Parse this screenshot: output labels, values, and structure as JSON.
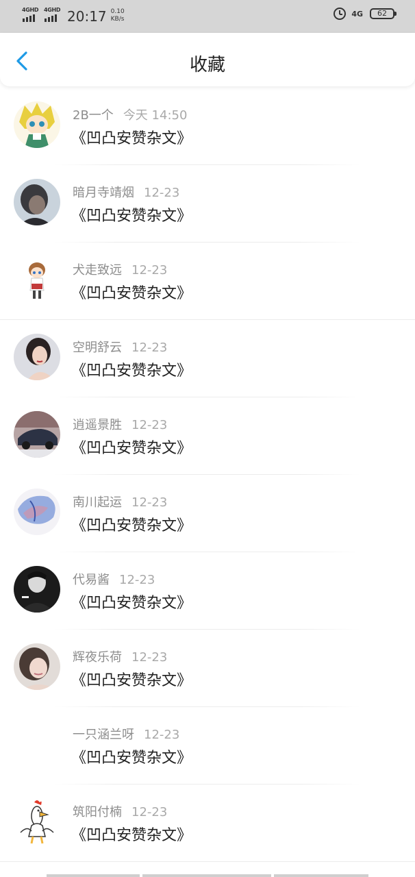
{
  "status_bar": {
    "signal1": "4GHD",
    "signal2": "4GHD",
    "time": "20:17",
    "speed_value": "0.10",
    "speed_unit": "KB/s",
    "network": "4G",
    "battery": "62"
  },
  "header": {
    "title": "收藏",
    "back_icon": "chevron-left-icon",
    "accent_color": "#1e9ae6"
  },
  "items": [
    {
      "author": "2B一个",
      "date": "今天 14:50",
      "title": "《凹凸安赞杂文》",
      "avatar": "anime-girl"
    },
    {
      "author": "暗月寺靖烟",
      "date": "12-23",
      "title": "《凹凸安赞杂文》",
      "avatar": "photo-dark"
    },
    {
      "author": "犬走致远",
      "date": "12-23",
      "title": "《凹凸安赞杂文》",
      "avatar": "anime-boy"
    },
    {
      "author": "空明舒云",
      "date": "12-23",
      "title": "《凹凸安赞杂文》",
      "avatar": "photo-woman"
    },
    {
      "author": "逍遥景胜",
      "date": "12-23",
      "title": "《凹凸安赞杂文》",
      "avatar": "photo-car"
    },
    {
      "author": "南川起运",
      "date": "12-23",
      "title": "《凹凸安赞杂文》",
      "avatar": "anime-blue"
    },
    {
      "author": "代易酱",
      "date": "12-23",
      "title": "《凹凸安赞杂文》",
      "avatar": "photo-man"
    },
    {
      "author": "辉夜乐荷",
      "date": "12-23",
      "title": "《凹凸安赞杂文》",
      "avatar": "photo-girl"
    },
    {
      "author": "一只涵兰呀",
      "date": "12-23",
      "title": "《凹凸安赞杂文》",
      "avatar": "none"
    },
    {
      "author": "筑阳付楠",
      "date": "12-23",
      "title": "《凹凸安赞杂文》",
      "avatar": "chicken-cartoon"
    }
  ]
}
